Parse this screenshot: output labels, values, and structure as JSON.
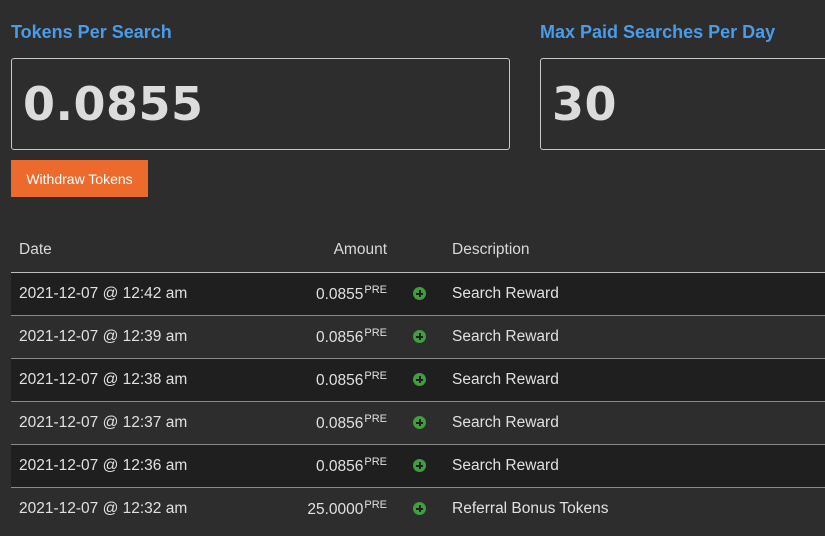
{
  "stats": {
    "tokens_per_search": {
      "title": "Tokens Per Search",
      "value": "0.0855"
    },
    "max_paid_searches": {
      "title": "Max Paid Searches Per Day",
      "value": "30"
    }
  },
  "actions": {
    "withdraw_label": "Withdraw Tokens"
  },
  "colors": {
    "accent_blue": "#4a9be8",
    "button_orange": "#ec6a2c",
    "plus_green": "#3f9e3f"
  },
  "table": {
    "headers": {
      "date": "Date",
      "amount": "Amount",
      "description": "Description"
    },
    "rows": [
      {
        "date": "2021-12-07 @ 12:42 am",
        "amount": "0.0855",
        "unit": "PRE",
        "icon": "plus-circle-icon",
        "description": "Search Reward"
      },
      {
        "date": "2021-12-07 @ 12:39 am",
        "amount": "0.0856",
        "unit": "PRE",
        "icon": "plus-circle-icon",
        "description": "Search Reward"
      },
      {
        "date": "2021-12-07 @ 12:38 am",
        "amount": "0.0856",
        "unit": "PRE",
        "icon": "plus-circle-icon",
        "description": "Search Reward"
      },
      {
        "date": "2021-12-07 @ 12:37 am",
        "amount": "0.0856",
        "unit": "PRE",
        "icon": "plus-circle-icon",
        "description": "Search Reward"
      },
      {
        "date": "2021-12-07 @ 12:36 am",
        "amount": "0.0856",
        "unit": "PRE",
        "icon": "plus-circle-icon",
        "description": "Search Reward"
      },
      {
        "date": "2021-12-07 @ 12:32 am",
        "amount": "25.0000",
        "unit": "PRE",
        "icon": "plus-circle-icon",
        "description": "Referral Bonus Tokens"
      }
    ]
  }
}
